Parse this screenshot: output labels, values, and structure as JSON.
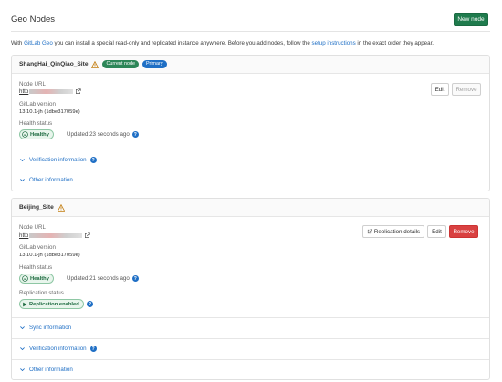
{
  "page": {
    "title": "Geo Nodes",
    "new_node_label": "New node"
  },
  "intro": {
    "prefix": "With ",
    "geo_link": "GitLab Geo",
    "middle": " you can install a special read-only and replicated instance anywhere. Before you add nodes, follow the ",
    "setup_link": "setup instructions",
    "suffix": " in the exact order they appear."
  },
  "nodes": [
    {
      "name": "ShangHai_QinQiao_Site",
      "badges": [
        "Current node",
        "Primary"
      ],
      "url_label": "Node URL",
      "url_prefix": "http",
      "version_label": "GitLab version",
      "version": "13.10.1-jh (1dbe317059e)",
      "health_label": "Health status",
      "health": "Healthy",
      "updated": "Updated 23 seconds ago",
      "edit_label": "Edit",
      "remove_label": "Remove",
      "sections": [
        "Verification information",
        "Other information"
      ]
    },
    {
      "name": "Beijing_Site",
      "url_label": "Node URL",
      "url_prefix": "http",
      "version_label": "GitLab version",
      "version": "13.10.1-jh (1dbe317059e)",
      "health_label": "Health status",
      "health": "Healthy",
      "updated": "Updated 21 seconds ago",
      "replication_label": "Replication status",
      "replication": "Replication enabled",
      "replication_details_label": "Replication details",
      "edit_label": "Edit",
      "remove_label": "Remove",
      "sections": [
        "Sync information",
        "Verification information",
        "Other information"
      ]
    }
  ],
  "colors": {
    "primary_green": "#1f7b4d",
    "link_blue": "#1f6fc5",
    "danger_red": "#d94141",
    "warning_orange": "#c27c0e"
  }
}
